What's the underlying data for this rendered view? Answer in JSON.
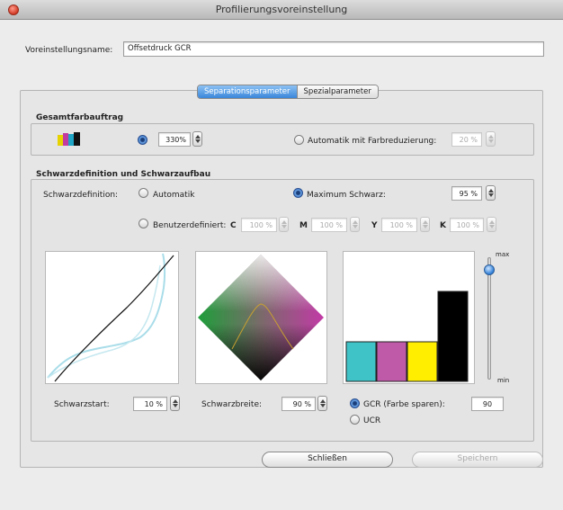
{
  "window": {
    "title": "Profilierungsvoreinstellung"
  },
  "preset": {
    "label": "Voreinstellungsname:",
    "value": "Offsetdruck GCR"
  },
  "tabs": [
    {
      "label": "Separationsparameter",
      "active": true
    },
    {
      "label": "Spezialparameter",
      "active": false
    }
  ],
  "total_ink": {
    "heading": "Gesamtfarbauftrag",
    "icon": "ink-cartridges-icon",
    "manual_value": "330%",
    "auto_label": "Automatik mit Farbreduzierung:",
    "auto_value": "20 %"
  },
  "black": {
    "heading": "Schwarzdefinition und Schwarzaufbau",
    "definition_label": "Schwarzdefinition:",
    "auto_label": "Automatik",
    "max_label": "Maximum Schwarz:",
    "max_value": "95 %",
    "custom_label": "Benutzerdefiniert:",
    "channels": [
      {
        "letter": "C",
        "value": "100 %"
      },
      {
        "letter": "M",
        "value": "100 %"
      },
      {
        "letter": "Y",
        "value": "100 %"
      },
      {
        "letter": "K",
        "value": "100 %"
      }
    ],
    "start_label": "Schwarzstart:",
    "start_value": "10 %",
    "width_label": "Schwarzbreite:",
    "width_value": "90 %",
    "gcr_label": "GCR (Farbe sparen):",
    "gcr_value": "90",
    "ucr_label": "UCR",
    "slider_max": "max",
    "slider_min": "min",
    "slider_level": 0.9
  },
  "bars": [
    {
      "name": "Cyan",
      "color": "#3fc3c7",
      "value": 0.44
    },
    {
      "name": "Magenta",
      "color": "#bf5aa8",
      "value": 0.44
    },
    {
      "name": "Yellow",
      "color": "#ffee00",
      "value": 0.44
    },
    {
      "name": "Black",
      "color": "#000000",
      "value": 1.0
    }
  ],
  "buttons": {
    "close": "Schließen",
    "save": "Speichern"
  }
}
